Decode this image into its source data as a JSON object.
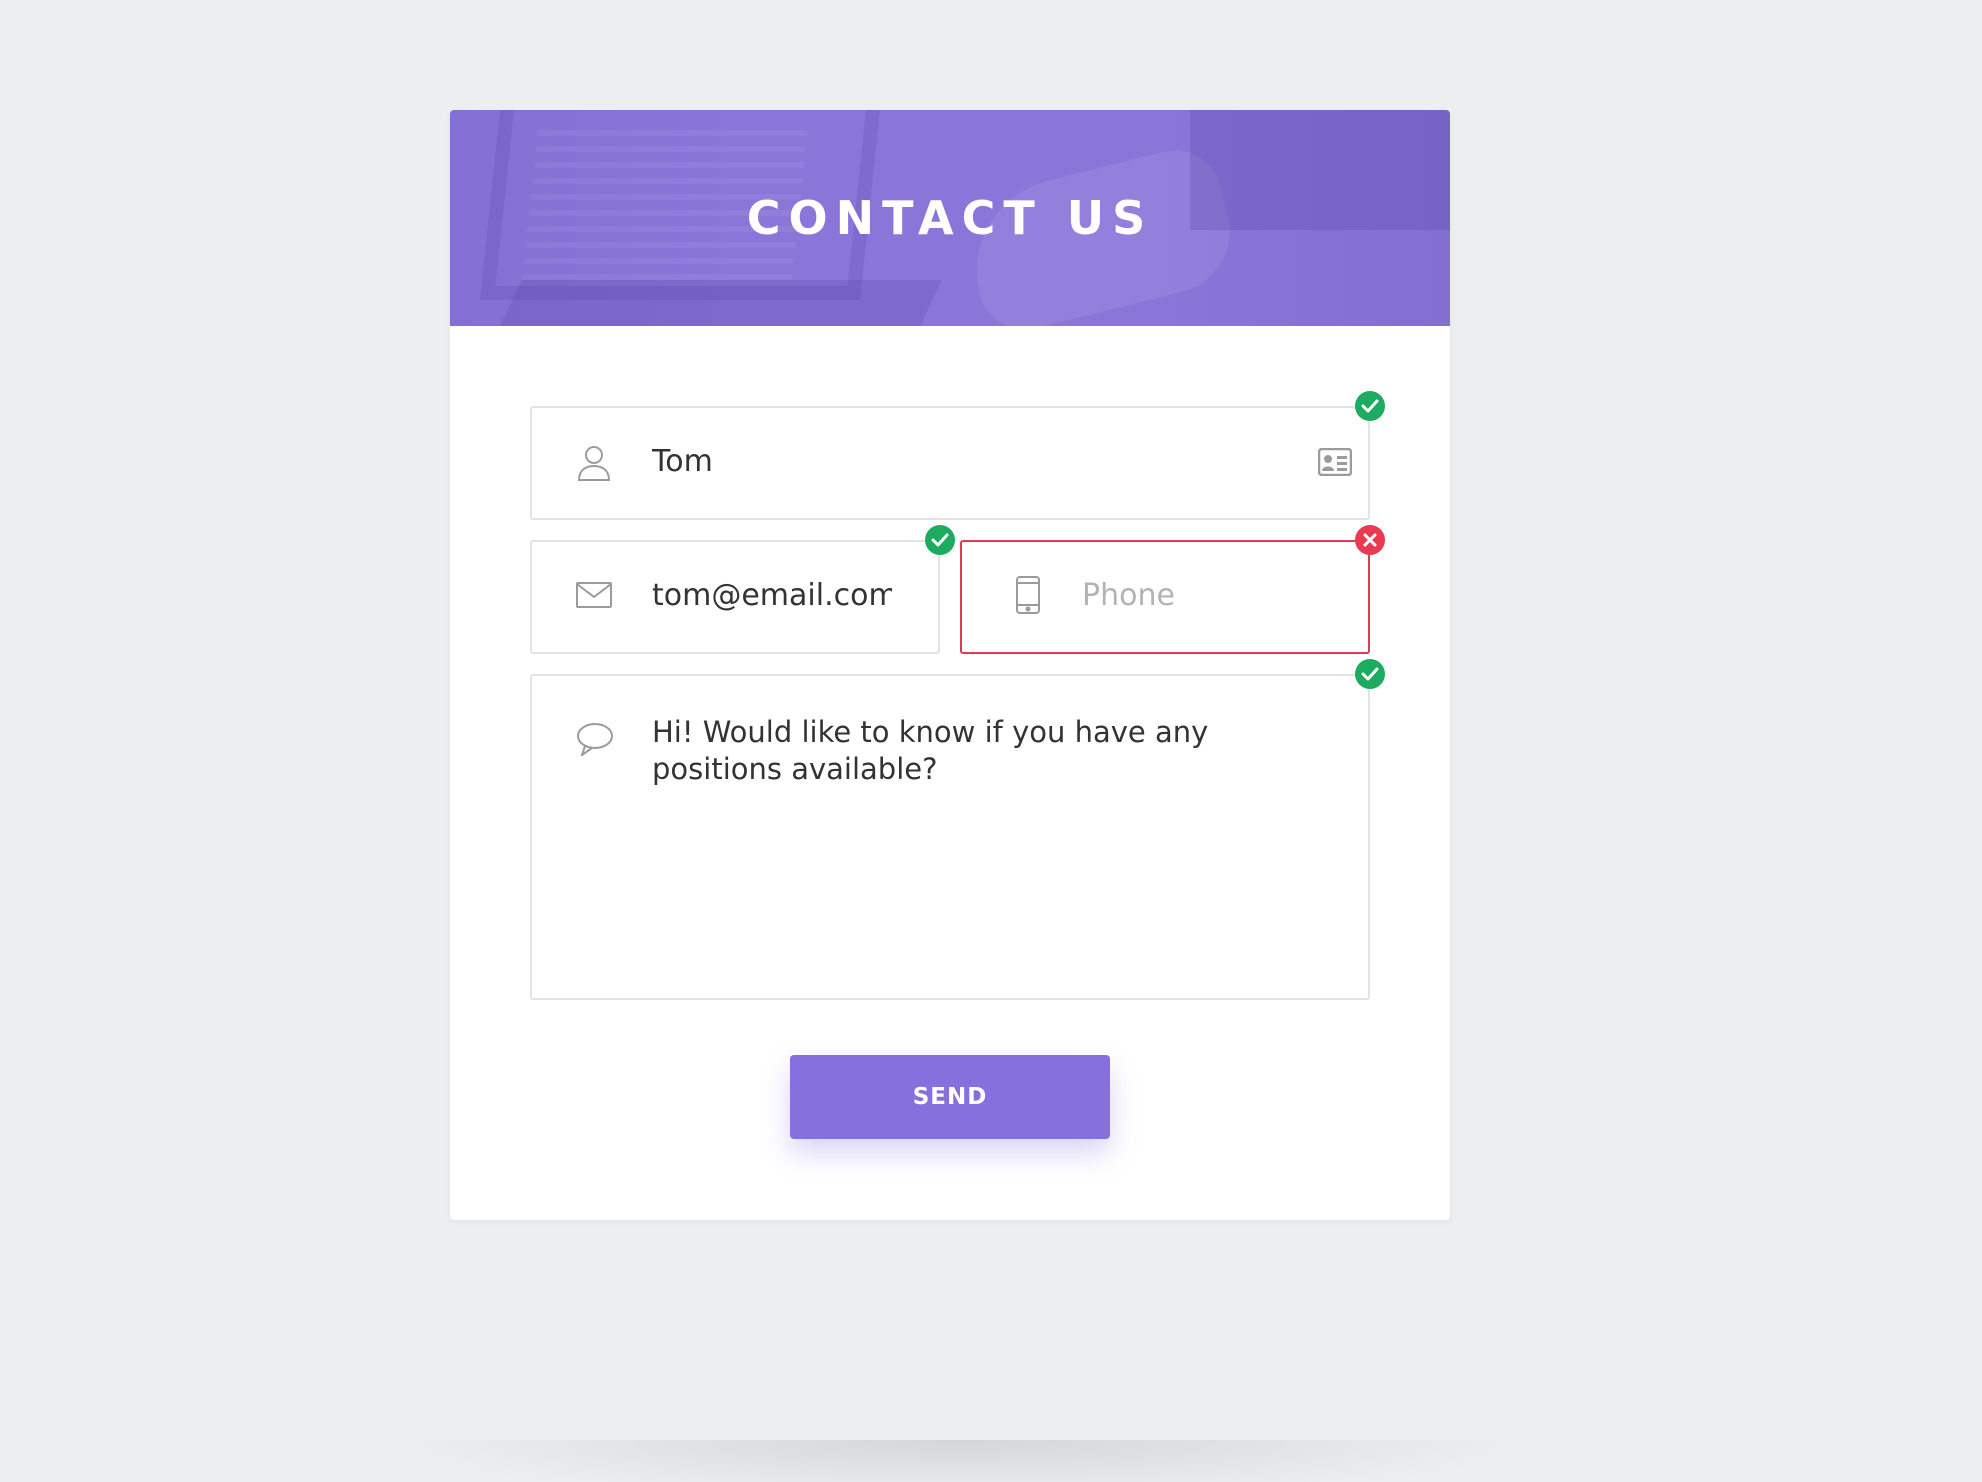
{
  "header": {
    "title": "CONTACT US"
  },
  "form": {
    "name": {
      "value": "Tom",
      "status": "valid",
      "icon": "user-icon",
      "trailing_icon": "contact-card-icon"
    },
    "email": {
      "value": "tom@email.com",
      "status": "valid",
      "icon": "envelope-icon"
    },
    "phone": {
      "value": "",
      "placeholder": "Phone",
      "status": "invalid",
      "icon": "mobile-phone-icon"
    },
    "message": {
      "value": "Hi! Would like to know if you have any positions available?",
      "status": "valid",
      "icon": "speech-bubble-icon"
    },
    "send_label": "SEND"
  },
  "colors": {
    "accent": "#8670dd",
    "header_bg": "#8a76d9",
    "valid": "#1dab5f",
    "invalid": "#e83a51",
    "page_bg": "#ebeff0"
  }
}
